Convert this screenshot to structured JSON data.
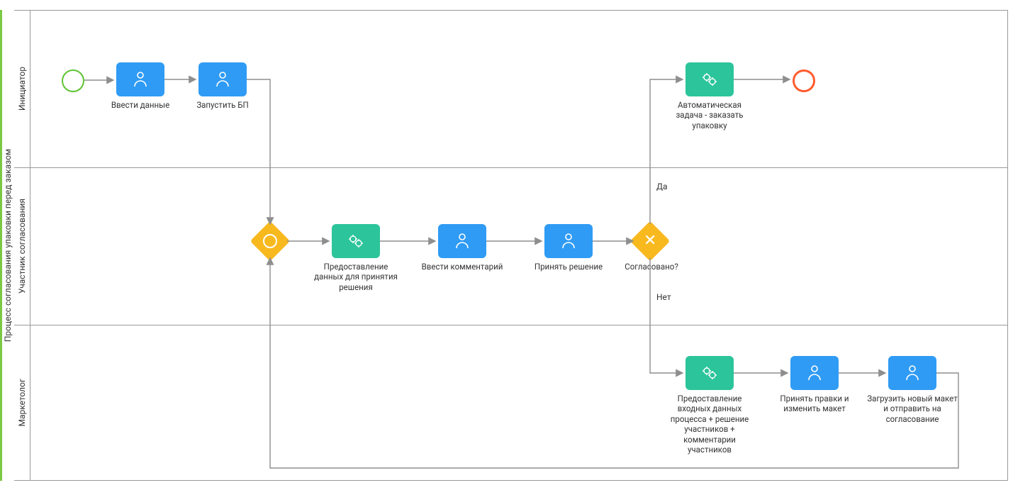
{
  "pool": {
    "title": "Процесс согласования упаковки перед заказом"
  },
  "lanes": {
    "initiator": "Инициатор",
    "approver": "Участник согласования",
    "marketer": "Маркетолог"
  },
  "tasks": {
    "enter_data": "Ввести данные",
    "start_bp": "Запустить БП",
    "provide_decision_data": "Предоставление данных для принятия решения",
    "enter_comment": "Ввести комментарий",
    "make_decision": "Принять решение",
    "auto_order_packaging": "Автоматическая задача - заказать упаковку",
    "provide_input_data": "Предоставление входных данных процесса + решение участников + комментарии участников",
    "accept_edits": "Принять правки и изменить макет",
    "upload_new_layout": "Загрузить новый макет и отправить на согласование"
  },
  "gateways": {
    "inclusive": "",
    "exclusive": "Согласовано?"
  },
  "flow_labels": {
    "yes": "Да",
    "no": "Нет"
  },
  "colors": {
    "blue": "#2f9bf4",
    "green": "#2cc49b",
    "yellow": "#f8b91f",
    "start": "#5ec232",
    "end": "#ff5b2e",
    "accent": "#7ac943"
  },
  "icons": {
    "user": "user-icon",
    "gear": "process-icon"
  }
}
